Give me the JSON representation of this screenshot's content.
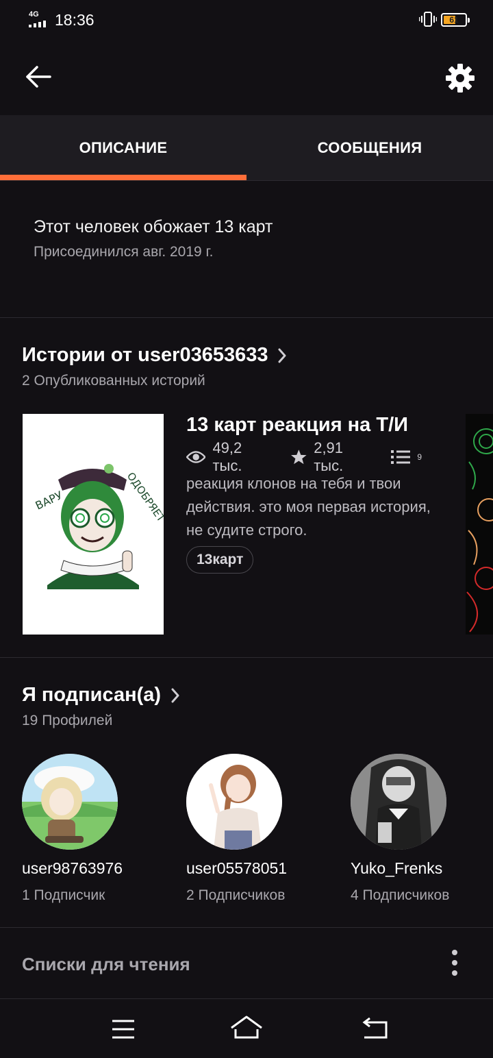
{
  "status_bar": {
    "network": "4G",
    "time": "18:36",
    "battery_level": "61"
  },
  "tabs": [
    {
      "label": "ОПИСАНИЕ",
      "active": true
    },
    {
      "label": "СООБЩЕНИЯ",
      "active": false
    }
  ],
  "about": {
    "description": "Этот человек обожает 13 карт",
    "joined": "Присоединился авг. 2019 г."
  },
  "stories": {
    "title": "Истории от user03653633",
    "subtitle": "2 Опубликованных историй",
    "items": [
      {
        "title": "13 карт реакция на Т/И",
        "reads": "49,2 тыс.",
        "votes": "2,91 тыс.",
        "parts": "9",
        "description": "реакция клонов на тебя и твои действия. это моя первая история, не судите строго.",
        "tag": "13карт",
        "cover_text_left": "ВАРУ",
        "cover_text_right": "ОДОБРЯЕТ"
      }
    ]
  },
  "following": {
    "title": "Я подписан(а)",
    "subtitle": "19 Профилей",
    "profiles": [
      {
        "name": "user98763976",
        "followers": "1 Подписчик"
      },
      {
        "name": "user05578051",
        "followers": "2 Подписчиков"
      },
      {
        "name": "Yuko_Frenks",
        "followers": "4 Подписчиков"
      }
    ]
  },
  "reading_lists": {
    "title": "Списки для чтения"
  },
  "colors": {
    "accent": "#ff6e39",
    "background": "#121014",
    "tab_bar": "#1e1c21",
    "muted_text": "#a9a7ad"
  },
  "icons": [
    "back-arrow-icon",
    "gear-icon",
    "eye-icon",
    "star-icon",
    "list-icon",
    "chevron-right-icon",
    "more-vertical-icon",
    "menu-icon",
    "home-icon",
    "back-nav-icon",
    "vibrate-icon",
    "battery-icon",
    "signal-icon"
  ]
}
